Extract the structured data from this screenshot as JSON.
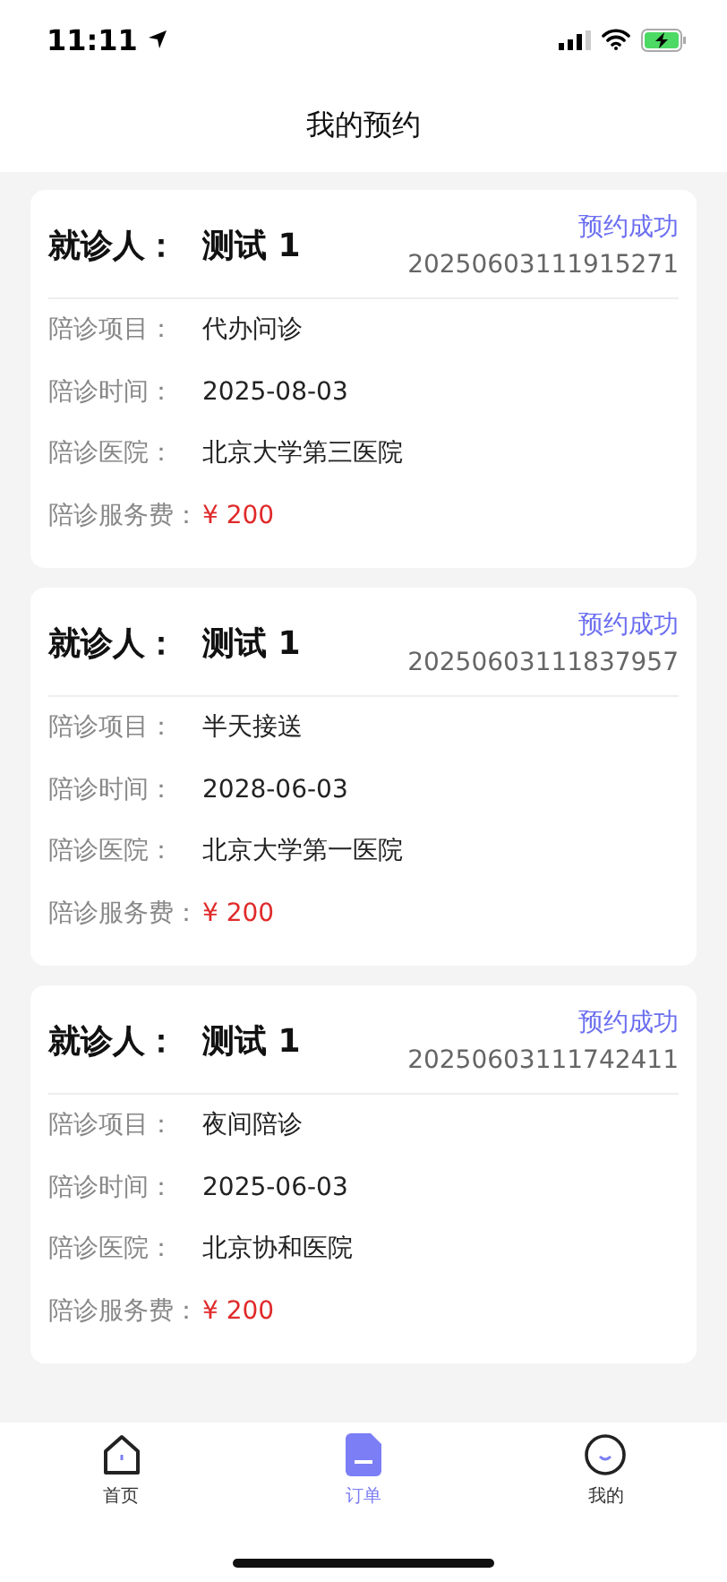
{
  "status_bar": {
    "time": "11:11"
  },
  "header": {
    "title": "我的预约"
  },
  "appointments": [
    {
      "patient_label": "就诊人：",
      "patient": "测试 1",
      "status": "预约成功",
      "order_no": "20250603111915271",
      "fields": [
        {
          "label": "陪诊项目：",
          "value": "代办问诊",
          "kind": "text"
        },
        {
          "label": "陪诊时间：",
          "value": "2025-08-03",
          "kind": "text"
        },
        {
          "label": "陪诊医院：",
          "value": "北京大学第三医院",
          "kind": "text"
        },
        {
          "label": "陪诊服务费：",
          "value": "¥ 200",
          "kind": "price"
        }
      ]
    },
    {
      "patient_label": "就诊人：",
      "patient": "测试 1",
      "status": "预约成功",
      "order_no": "20250603111837957",
      "fields": [
        {
          "label": "陪诊项目：",
          "value": "半天接送",
          "kind": "text"
        },
        {
          "label": "陪诊时间：",
          "value": "2028-06-03",
          "kind": "text"
        },
        {
          "label": "陪诊医院：",
          "value": "北京大学第一医院",
          "kind": "text"
        },
        {
          "label": "陪诊服务费：",
          "value": "¥ 200",
          "kind": "price"
        }
      ]
    },
    {
      "patient_label": "就诊人：",
      "patient": "测试 1",
      "status": "预约成功",
      "order_no": "20250603111742411",
      "fields": [
        {
          "label": "陪诊项目：",
          "value": "夜间陪诊",
          "kind": "text"
        },
        {
          "label": "陪诊时间：",
          "value": "2025-06-03",
          "kind": "text"
        },
        {
          "label": "陪诊医院：",
          "value": "北京协和医院",
          "kind": "text"
        },
        {
          "label": "陪诊服务费：",
          "value": "¥ 200",
          "kind": "price"
        }
      ]
    }
  ],
  "tab_bar": [
    {
      "label": "首页",
      "kind": "home",
      "selected": false
    },
    {
      "label": "订单",
      "kind": "orders",
      "selected": true
    },
    {
      "label": "我的",
      "kind": "me",
      "selected": false
    }
  ]
}
